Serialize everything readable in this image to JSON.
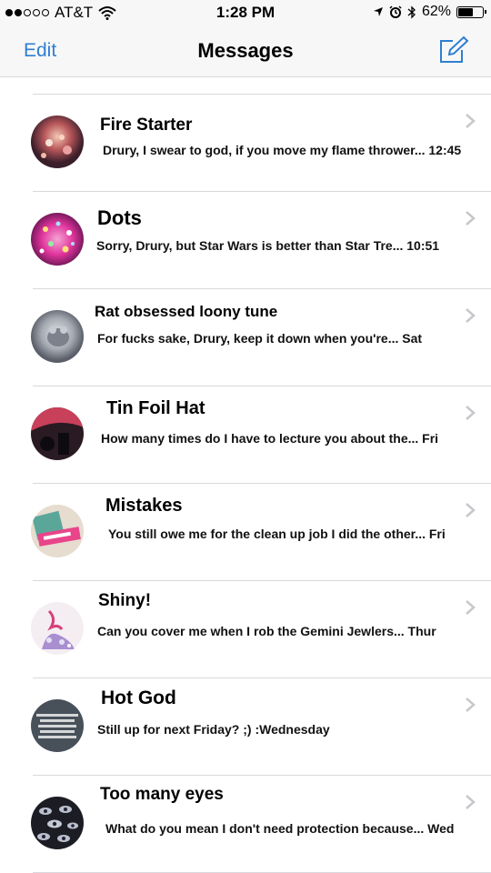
{
  "status_bar": {
    "carrier": "AT&T",
    "time": "1:28 PM",
    "battery": "62%",
    "battery_level": 0.62
  },
  "nav": {
    "edit_label": "Edit",
    "title": "Messages",
    "compose_icon": "compose-icon"
  },
  "colors": {
    "accent": "#2f7fd0",
    "separator": "#d9d9dd",
    "chevron": "#c7c7cc"
  },
  "conversations": [
    {
      "name": "Fire Starter",
      "preview": "Drury, I swear to god, if you move my flame thrower... 12:45",
      "avatar": "fire-avatar"
    },
    {
      "name": "Dots",
      "preview": "Sorry, Drury, but Star Wars is better than Star Tre... 10:51",
      "avatar": "dots-avatar"
    },
    {
      "name": "Rat obsessed loony tune",
      "preview": "For fucks sake, Drury, keep it down when you're... Sat",
      "avatar": "rat-avatar"
    },
    {
      "name": "Tin Foil Hat",
      "preview": "How many times do I have to lecture you about the... Fri",
      "avatar": "tinfoil-avatar"
    },
    {
      "name": "Mistakes",
      "preview": "You still owe me for the clean up job I did the other... Fri",
      "avatar": "mistakes-avatar"
    },
    {
      "name": "Shiny!",
      "preview": "Can you cover me when I rob the Gemini Jewlers... Thur",
      "avatar": "shiny-avatar"
    },
    {
      "name": "Hot God",
      "preview": "Still up for next Friday? ;) :Wednesday",
      "avatar": "robbery-avatar"
    },
    {
      "name": "Too many eyes",
      "preview": "What do you mean I don't need protection because... Wed",
      "avatar": "eyes-avatar"
    }
  ]
}
